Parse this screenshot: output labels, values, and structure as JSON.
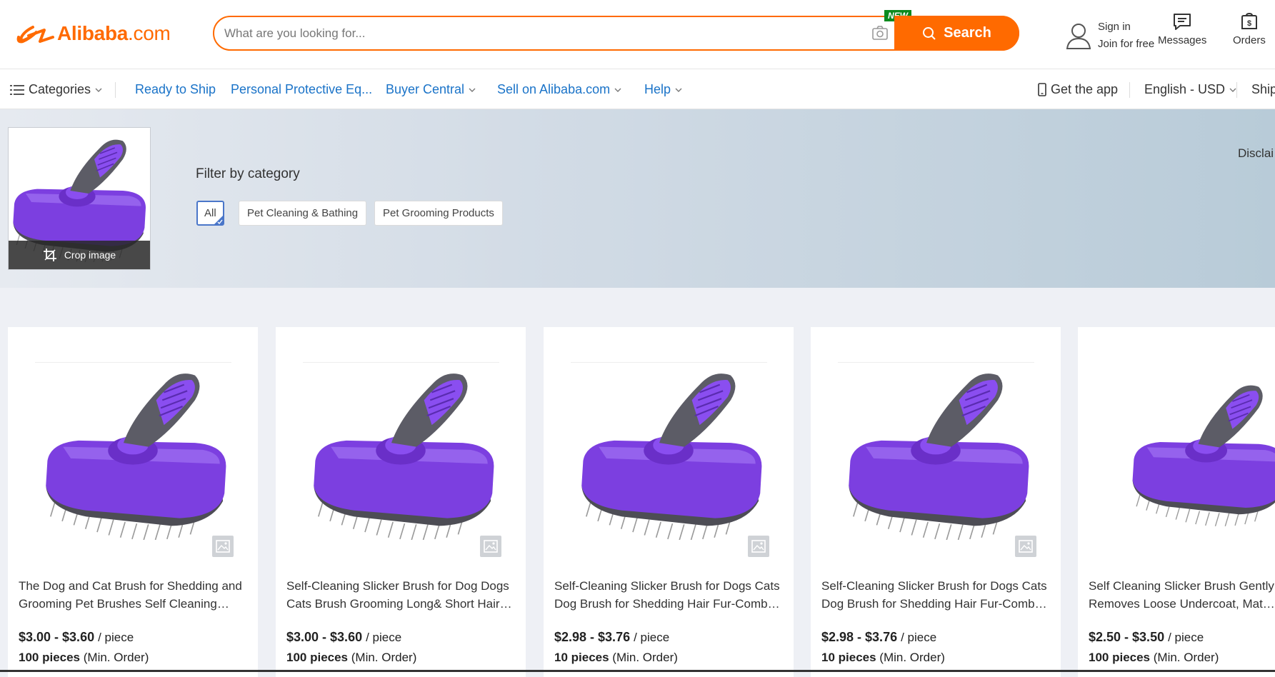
{
  "header": {
    "logo_text": "Alibaba",
    "logo_suffix": ".com",
    "search_placeholder": "What are you looking for...",
    "new_badge": "NEW",
    "search_button": "Search",
    "sign_in": "Sign in",
    "join": "Join for free",
    "messages": "Messages",
    "orders": "Orders",
    "brand_color": "#ff6a00"
  },
  "nav": {
    "categories": "Categories",
    "items": [
      "Ready to Ship",
      "Personal Protective Eq...",
      "Buyer Central",
      "Sell on Alibaba.com",
      "Help"
    ],
    "get_app": "Get the app",
    "language": "English - USD",
    "ship": "Ship"
  },
  "banner": {
    "crop_label": "Crop image",
    "filter_title": "Filter by category",
    "chips": [
      "All",
      "Pet Cleaning & Bathing",
      "Pet Grooming Products"
    ],
    "disclaimer": "Disclai"
  },
  "products": [
    {
      "title": "The Dog and Cat Brush for Shedding and Grooming Pet Brushes Self Cleaning Slicker Brush",
      "price": "$3.00 - $3.60",
      "unit": "/ piece",
      "moq_qty": "100 pieces",
      "moq_label": "(Min. Order)"
    },
    {
      "title": "Self-Cleaning Slicker Brush for Dog Dogs Cats Brush Grooming Long& Short Haired Pets",
      "price": "$3.00 - $3.60",
      "unit": "/ piece",
      "moq_qty": "100 pieces",
      "moq_label": "(Min. Order)"
    },
    {
      "title": "Self-Cleaning Slicker Brush for Dogs Cats Dog Brush for Shedding Hair Fur-Comb Grooming",
      "price": "$2.98 - $3.76",
      "unit": "/ piece",
      "moq_qty": "10 pieces",
      "moq_label": "(Min. Order)"
    },
    {
      "title": "Self-Cleaning Slicker Brush for Dogs Cats Dog Brush for Shedding Hair Fur-Comb Grooming",
      "price": "$2.98 - $3.76",
      "unit": "/ piece",
      "moq_qty": "10 pieces",
      "moq_label": "(Min. Order)"
    },
    {
      "title": "Self Cleaning Slicker Brush Gently Removes Loose Undercoat, Mats and Tangled Hair",
      "price": "$2.50 - $3.50",
      "unit": "/ piece",
      "moq_qty": "100 pieces",
      "moq_label": "(Min. Order)"
    }
  ]
}
